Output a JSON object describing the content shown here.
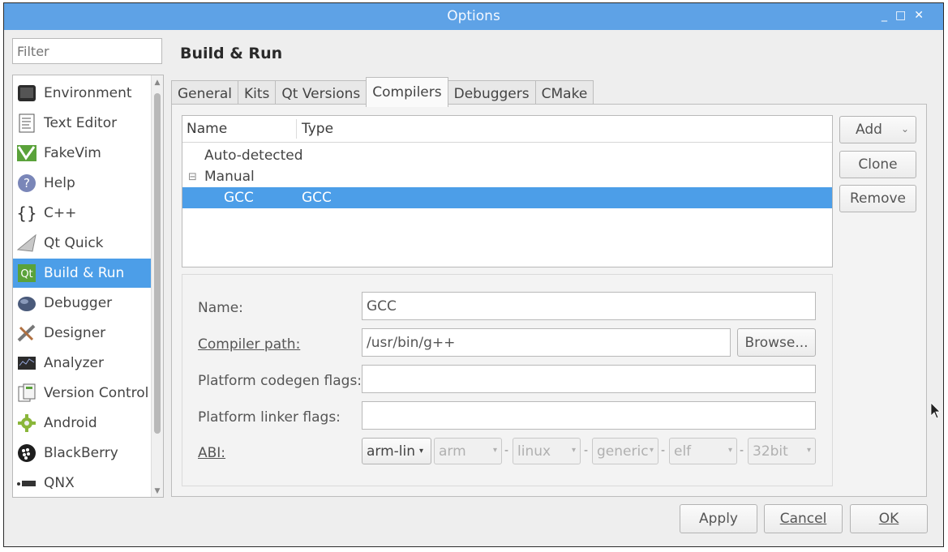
{
  "window": {
    "title": "Options"
  },
  "filter": {
    "placeholder": "Filter"
  },
  "sidebar": {
    "items": [
      {
        "label": "Environment",
        "icon": "monitor-icon"
      },
      {
        "label": "Text Editor",
        "icon": "text-document-icon"
      },
      {
        "label": "FakeVim",
        "icon": "fakevim-icon"
      },
      {
        "label": "Help",
        "icon": "help-icon"
      },
      {
        "label": "C++",
        "icon": "braces-icon"
      },
      {
        "label": "Qt Quick",
        "icon": "qt-quick-icon"
      },
      {
        "label": "Build & Run",
        "icon": "build-run-icon",
        "selected": true
      },
      {
        "label": "Debugger",
        "icon": "debugger-icon"
      },
      {
        "label": "Designer",
        "icon": "designer-icon"
      },
      {
        "label": "Analyzer",
        "icon": "analyzer-icon"
      },
      {
        "label": "Version Control",
        "icon": "version-control-icon"
      },
      {
        "label": "Android",
        "icon": "android-icon"
      },
      {
        "label": "BlackBerry",
        "icon": "blackberry-icon"
      },
      {
        "label": "QNX",
        "icon": "qnx-icon"
      }
    ]
  },
  "page": {
    "title": "Build & Run"
  },
  "tabs": [
    "General",
    "Kits",
    "Qt Versions",
    "Compilers",
    "Debuggers",
    "CMake"
  ],
  "active_tab": "Compilers",
  "compiler_tree": {
    "columns": [
      "Name",
      "Type"
    ],
    "auto_detected": "Auto-detected",
    "manual": "Manual",
    "manual_expander": "⊟",
    "row": {
      "name": "GCC",
      "type": "GCC"
    }
  },
  "side_buttons": {
    "add": "Add",
    "clone": "Clone",
    "remove": "Remove"
  },
  "details": {
    "name_label": "Name:",
    "name_value": "GCC",
    "path_label": "Compiler path:",
    "path_value": "/usr/bin/g++",
    "browse": "Browse...",
    "codegen_label": "Platform codegen flags:",
    "codegen_value": "",
    "linker_label": "Platform linker flags:",
    "linker_value": "",
    "abi_label": "ABI:",
    "abi": [
      "arm-lin",
      "arm",
      "linux",
      "generic",
      "elf",
      "32bit"
    ],
    "abi_sep": "-"
  },
  "footer": {
    "apply": "Apply",
    "cancel": "Cancel",
    "ok": "OK"
  },
  "colors": {
    "titlebar": "#5ea2e6",
    "selection": "#4c9ee8"
  }
}
